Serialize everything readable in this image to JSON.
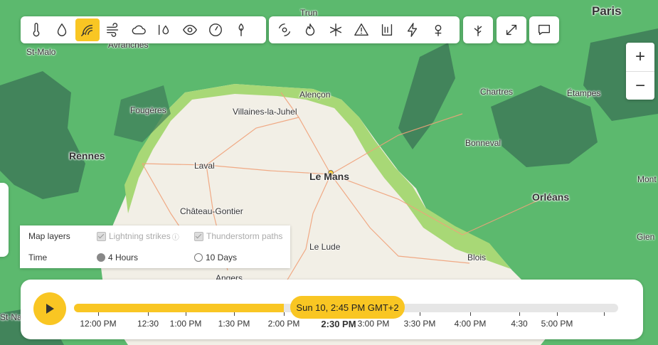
{
  "map": {
    "cities": [
      {
        "name": "Paris",
        "size": "l"
      },
      {
        "name": "Trun",
        "size": "s"
      },
      {
        "name": "St-Malo",
        "size": "s"
      },
      {
        "name": "Avranches",
        "size": "s"
      },
      {
        "name": "Alençon",
        "size": "s"
      },
      {
        "name": "Chartres",
        "size": "s"
      },
      {
        "name": "Étampes",
        "size": "s"
      },
      {
        "name": "Fougères",
        "size": "s"
      },
      {
        "name": "Villaines-la-Juhel",
        "size": "s"
      },
      {
        "name": "Rennes",
        "size": "m"
      },
      {
        "name": "Bonneval",
        "size": "s"
      },
      {
        "name": "Laval",
        "size": "s"
      },
      {
        "name": "Le Mans",
        "size": "m"
      },
      {
        "name": "Mont",
        "size": "s"
      },
      {
        "name": "Orléans",
        "size": "m"
      },
      {
        "name": "Château-Gontier",
        "size": "s"
      },
      {
        "name": "Gien",
        "size": "s"
      },
      {
        "name": "Le Lude",
        "size": "s"
      },
      {
        "name": "Blois",
        "size": "s"
      },
      {
        "name": "Angers",
        "size": "s"
      },
      {
        "name": "St-Na",
        "size": "s"
      }
    ],
    "colors": {
      "land": "#f2efe6",
      "risk_low": "#a8d876",
      "risk_mid": "#5cb96e",
      "risk_high": "#3d7a58",
      "roads": "#f0a27a",
      "water": "#aad3df"
    }
  },
  "toolbar": {
    "group1": [
      "thermometer-icon",
      "raindrop-icon",
      "lightning-radar-icon",
      "wind-icon",
      "cloud-icon",
      "humidity-icon",
      "eye-icon",
      "pressure-gauge-icon",
      "leaf-icon"
    ],
    "group1_active": "lightning-radar-icon",
    "group2": [
      "hurricane-icon",
      "fire-icon",
      "snowflake-icon",
      "warning-icon",
      "flood-icon",
      "lightning-bolt-icon",
      "pollen-icon"
    ],
    "group3": [
      "plant-icon"
    ],
    "group4": [
      "expand-icon"
    ],
    "group5": [
      "comment-icon"
    ]
  },
  "zoom": {
    "in": "+",
    "out": "−"
  },
  "layers": {
    "map_layers_label": "Map layers",
    "lightning_label": "Lightning strikes",
    "lightning_info": "ⓘ",
    "thunder_label": "Thunderstorm paths",
    "time_label": "Time",
    "opt_4h": "4 Hours",
    "opt_10d": "10 Days",
    "selected": "4 Hours"
  },
  "timeline": {
    "current": "Sun 10, 2:45 PM GMT+2",
    "progress": 0.386,
    "labels": [
      "12:00 PM",
      "12:30",
      "1:00 PM",
      "1:30 PM",
      "2:00 PM",
      "2:30 PM",
      "3:00 PM",
      "3:30 PM",
      "4:00 PM",
      "4:30",
      "5:00 PM"
    ],
    "now_label": "2:30 PM"
  }
}
